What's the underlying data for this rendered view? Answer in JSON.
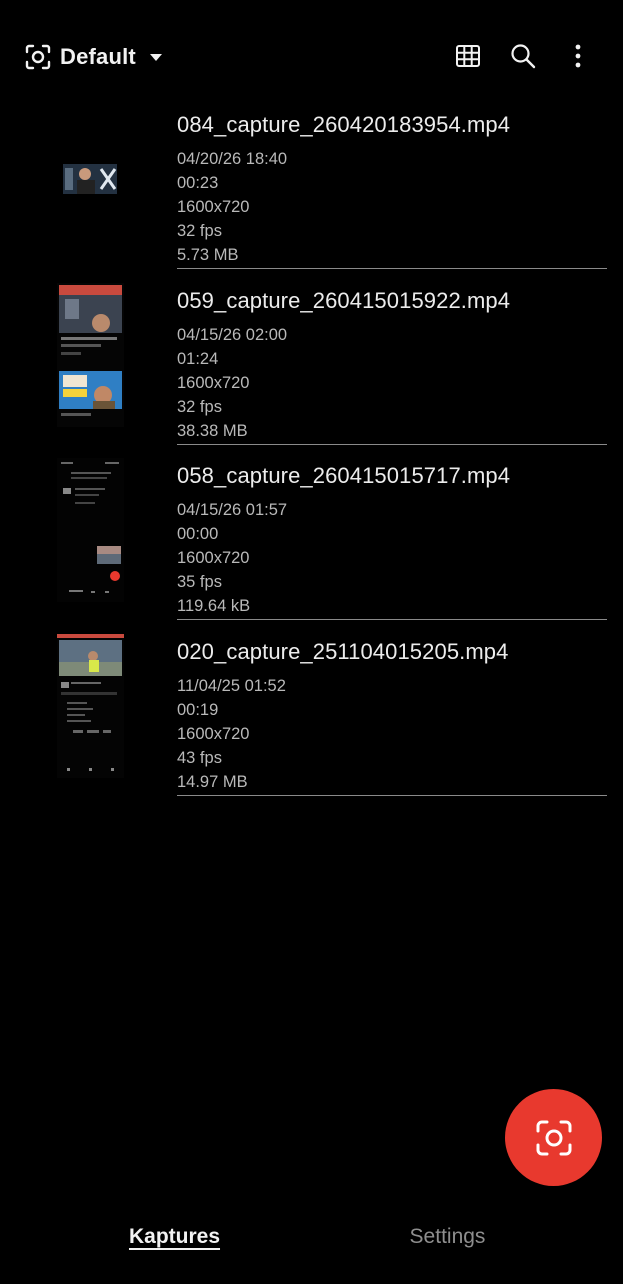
{
  "header": {
    "profile_title": "Default",
    "icons": {
      "profile": "capture-frame-icon",
      "grid": "grid-view-icon",
      "search": "search-icon",
      "more": "more-vert-icon"
    }
  },
  "recordings": [
    {
      "filename": "084_capture_260420183954.mp4",
      "date": "04/20/26 18:40",
      "duration": "00:23",
      "resolution": "1600x720",
      "fps": "32 fps",
      "size": "5.73 MB"
    },
    {
      "filename": "059_capture_260415015922.mp4",
      "date": "04/15/26 02:00",
      "duration": "01:24",
      "resolution": "1600x720",
      "fps": "32 fps",
      "size": "38.38 MB"
    },
    {
      "filename": "058_capture_260415015717.mp4",
      "date": "04/15/26 01:57",
      "duration": "00:00",
      "resolution": "1600x720",
      "fps": "35 fps",
      "size": "119.64 kB"
    },
    {
      "filename": "020_capture_251104015205.mp4",
      "date": "11/04/25 01:52",
      "duration": "00:19",
      "resolution": "1600x720",
      "fps": "43 fps",
      "size": "14.97 MB"
    }
  ],
  "fab": {
    "icon": "capture-frame-icon",
    "color": "#e8392e"
  },
  "bottom_nav": {
    "tabs": [
      "Kaptures",
      "Settings"
    ],
    "active": "Kaptures"
  }
}
